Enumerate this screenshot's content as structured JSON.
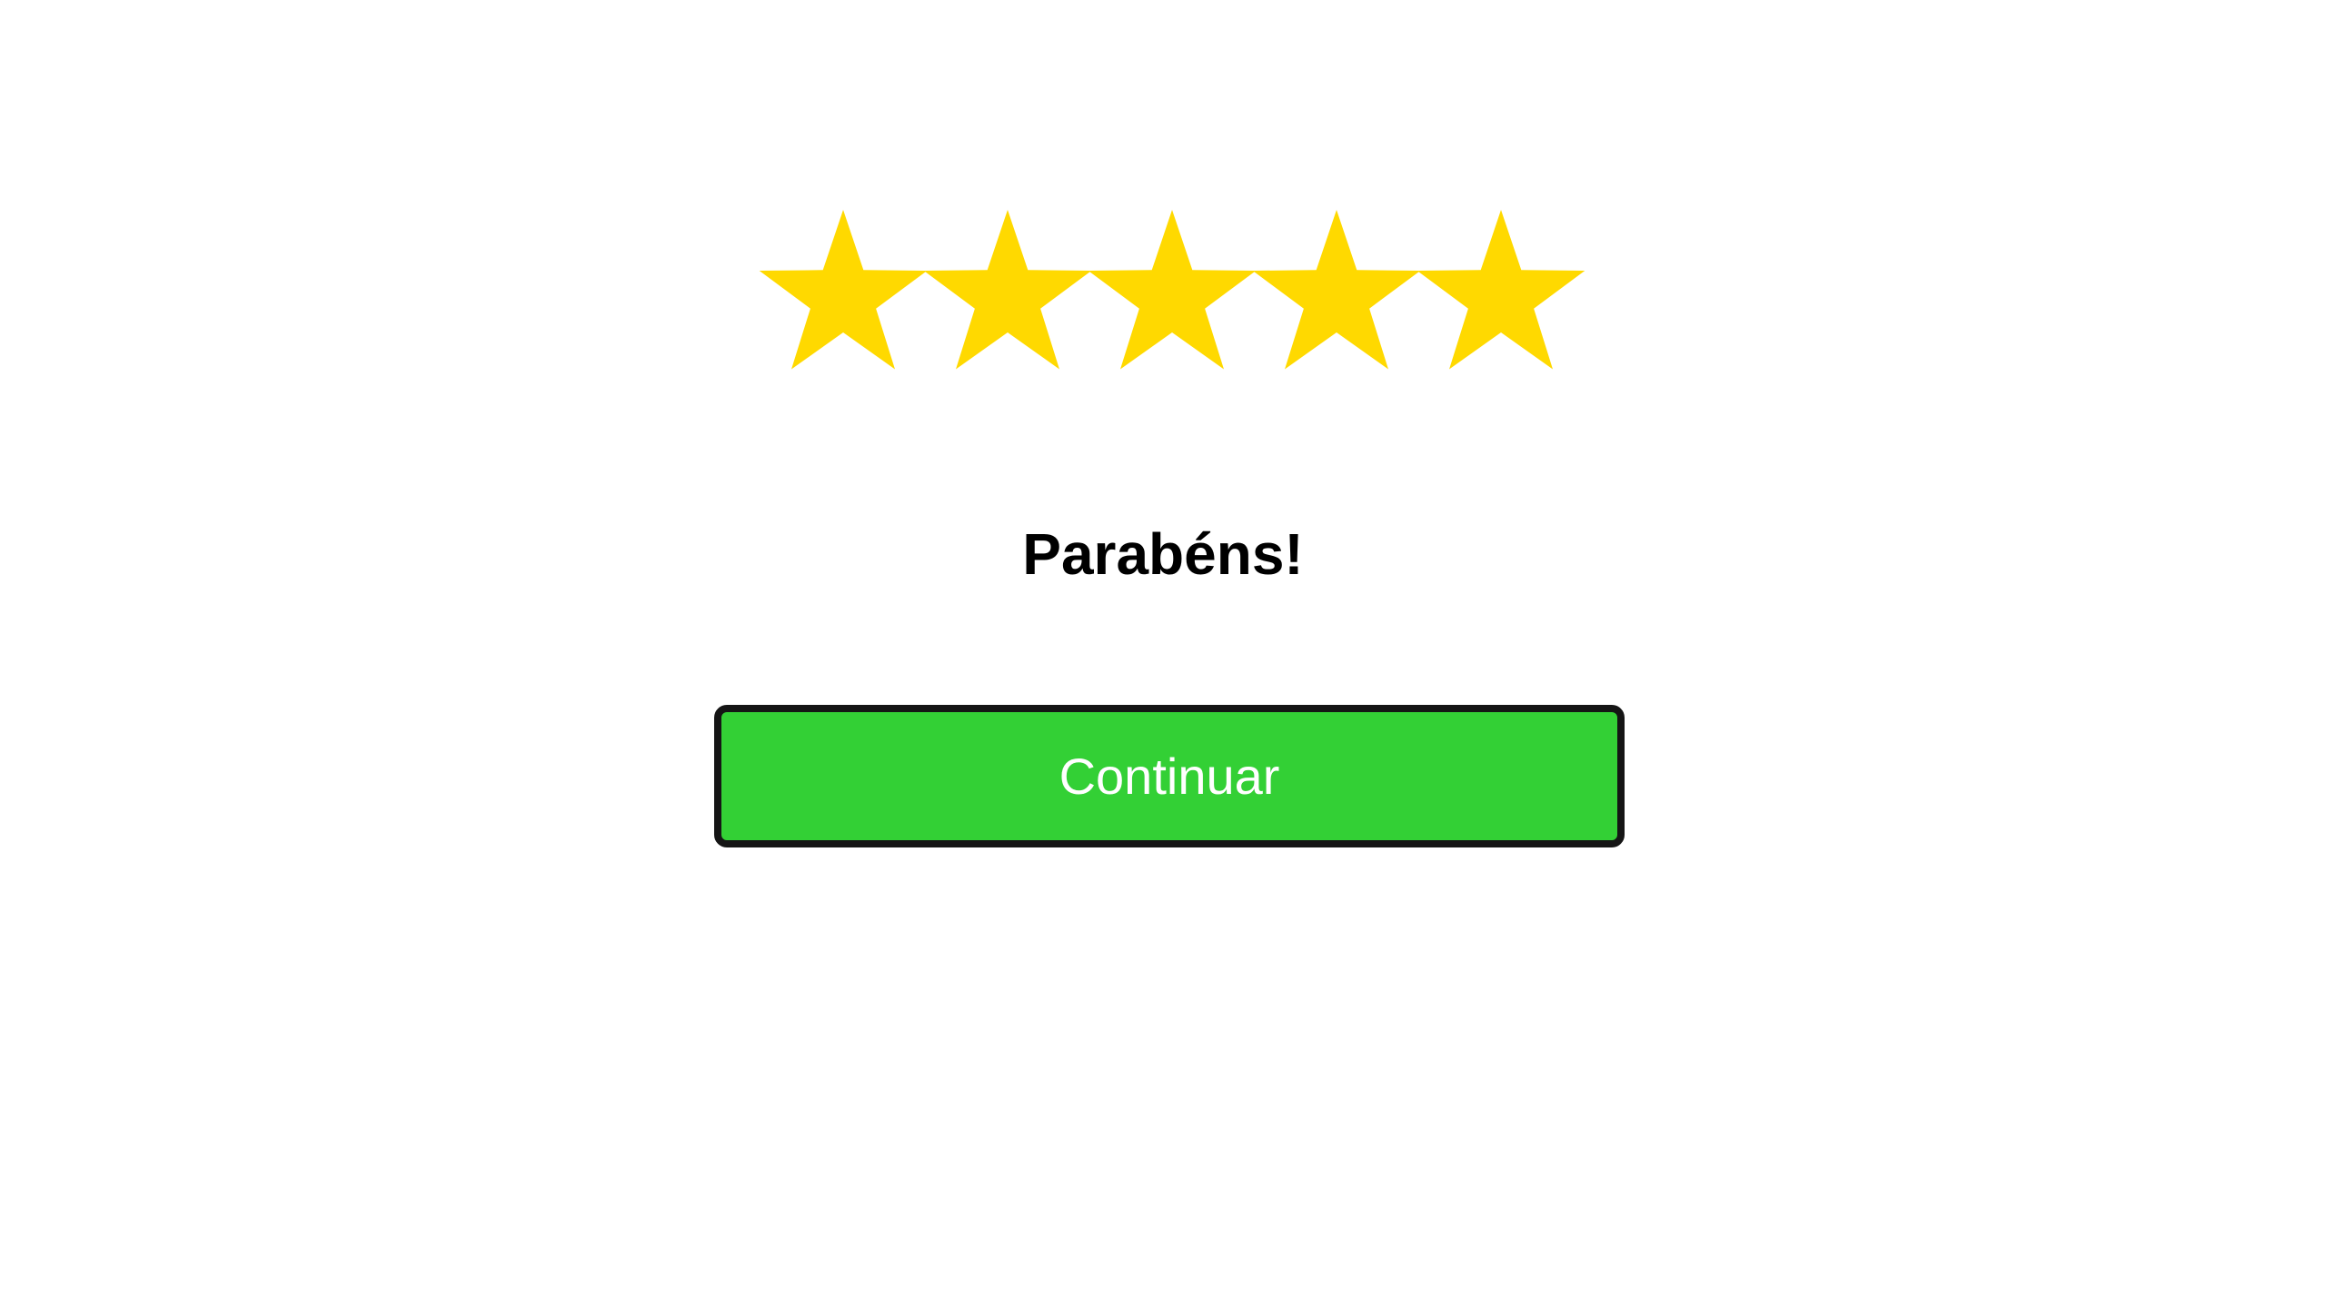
{
  "rating": {
    "value": 5,
    "max": 5,
    "star_color": "#FFD900",
    "icon": "star-icon"
  },
  "heading": {
    "text": "Parabéns!"
  },
  "continue_button": {
    "label": "Continuar",
    "background_color": "#33D035",
    "text_color": "#FFFFFF",
    "border_color": "#151515"
  }
}
